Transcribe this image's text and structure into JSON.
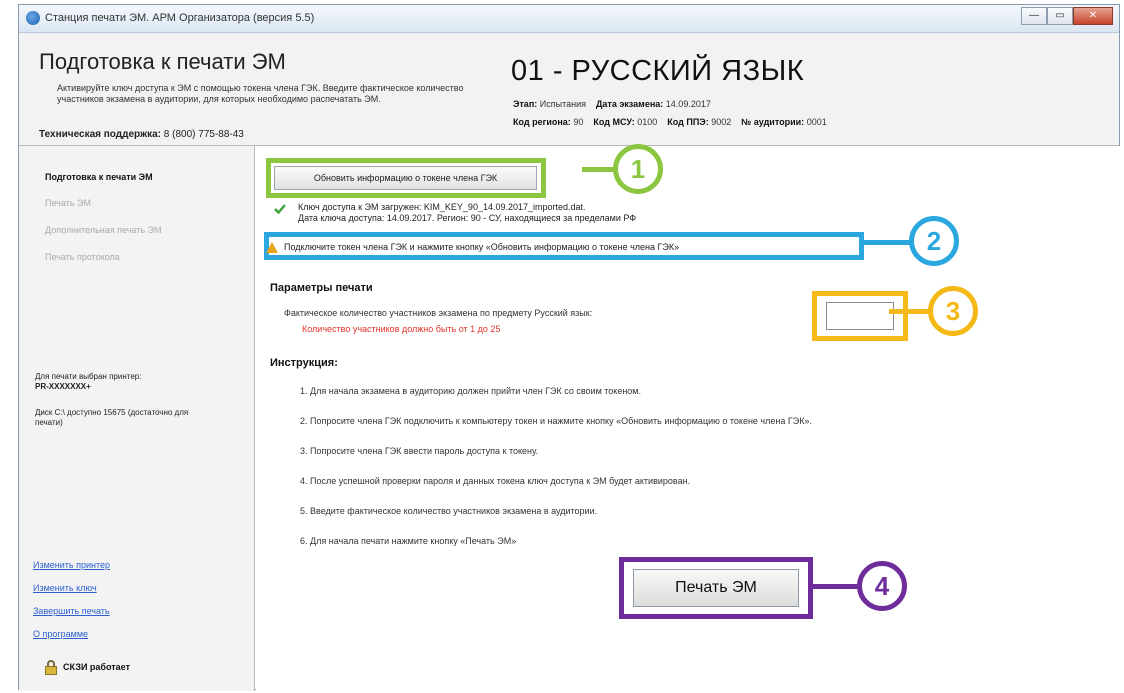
{
  "window": {
    "title": "Станция печати ЭМ. АРМ Организатора (версия 5.5)",
    "buttons": {
      "minimize": "—",
      "maximize": "▭",
      "close": "✕"
    }
  },
  "header": {
    "title": "Подготовка к печати ЭМ",
    "description": "Активируйте ключ доступа к ЭМ с помощью токена члена ГЭК. Введите фактическое количество участников экзамена в аудитории, для которых необходимо распечатать ЭМ.",
    "support_label": "Техническая поддержка:",
    "support_phone": "8 (800) 775-88-43",
    "subject": "01 - РУССКИЙ ЯЗЫК",
    "stage_label": "Этап:",
    "stage_value": "Испытания",
    "exam_date_label": "Дата экзамена:",
    "exam_date_value": "14.09.2017",
    "region_label": "Код региона:",
    "region_value": "90",
    "msu_label": "Код МСУ:",
    "msu_value": "0100",
    "ppe_label": "Код ППЭ:",
    "ppe_value": "9002",
    "auditorium_label": "№ аудитории:",
    "auditorium_value": "0001"
  },
  "sidebar": {
    "nav": [
      {
        "label": "Подготовка к печати ЭМ",
        "active": true
      },
      {
        "label": "Печать ЭМ",
        "active": false
      },
      {
        "label": "Дополнительная печать ЭМ",
        "active": false
      },
      {
        "label": "Печать протокола",
        "active": false
      }
    ],
    "printer_label": "Для печати выбран принтер:",
    "printer_name": "PR-XXXXXXX+",
    "disk_info": "Диск C:\\ доступно 15675 (достаточно для печати)",
    "links": [
      {
        "label": "Изменить принтер"
      },
      {
        "label": "Изменить ключ"
      },
      {
        "label": "Завершить печать"
      },
      {
        "label": "О программе"
      }
    ],
    "skzm_status": "СКЗИ работает"
  },
  "main": {
    "refresh_button": "Обновить информацию о токене члена ГЭК",
    "key_loaded": "Ключ доступа к ЭМ загружен: KIM_KEY_90_14.09.2017_imported.dat.",
    "key_details": "Дата ключа доступа: 14.09.2017. Регион: 90 - СУ, находящиеся за пределами РФ",
    "warning": "Подключите токен члена ГЭК и нажмите кнопку «Обновить информацию о токене члена ГЭК»",
    "params_title": "Параметры печати",
    "params_label": "Фактическое количество участников экзамена по предмету Русский язык:",
    "params_error": "Количество участников должно быть от 1 до 25",
    "participants_value": "",
    "instructions_title": "Инструкция:",
    "instructions": [
      "1. Для начала экзамена в аудиторию должен прийти член ГЭК со своим токеном.",
      "2. Попросите члена ГЭК подключить к компьютеру токен и нажмите кнопку «Обновить информацию о токене члена ГЭК».",
      "3. Попросите члена ГЭК ввести пароль доступа к токену.",
      "4. После успешной проверки пароля и данных токена ключ доступа к ЭМ будет активирован.",
      "5. Введите фактическое количество участников экзамена в аудитории.",
      "6. Для начала печати нажмите кнопку «Печать ЭМ»"
    ],
    "print_button": "Печать ЭМ"
  },
  "callouts": [
    {
      "number": "1",
      "color": "#8ac640"
    },
    {
      "number": "2",
      "color": "#2aa7de"
    },
    {
      "number": "3",
      "color": "#f4b916"
    },
    {
      "number": "4",
      "color": "#6e2d9b"
    }
  ]
}
